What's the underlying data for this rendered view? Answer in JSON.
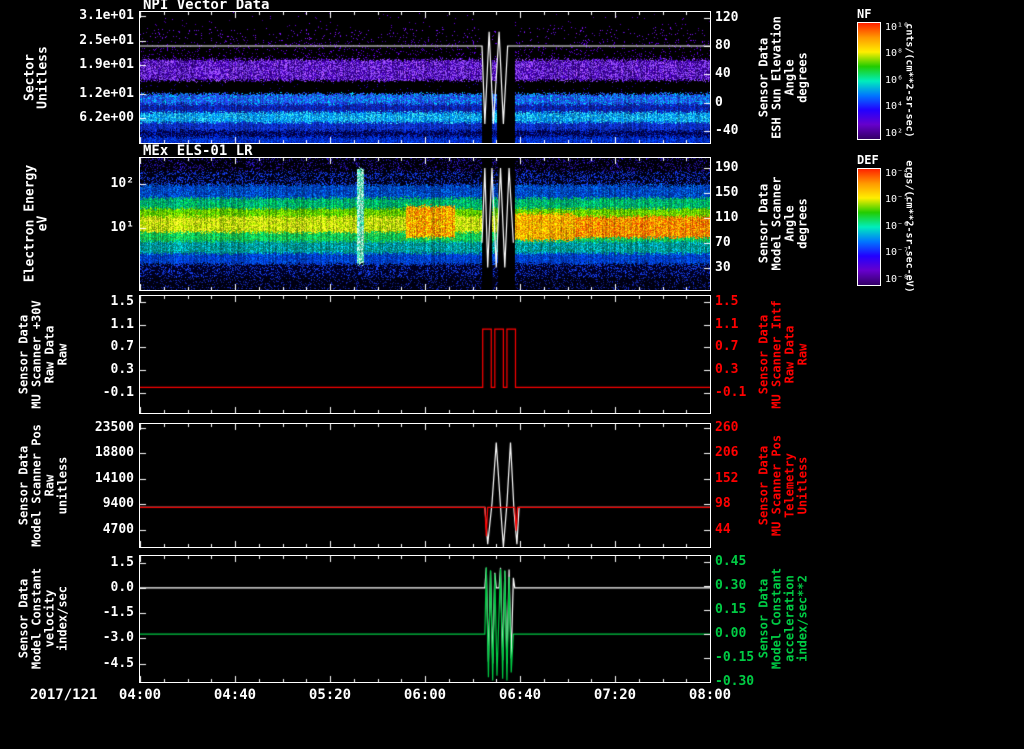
{
  "figure": {
    "background": "#000000"
  },
  "xaxis": {
    "date": "2017/121",
    "tick_labels": [
      "04:00",
      "04:40",
      "05:20",
      "06:00",
      "06:40",
      "07:20",
      "08:00"
    ],
    "minor_tick_minutes": 10,
    "major_tick_minutes": 40,
    "time_range": [
      "2017/121 04:00",
      "2017/121 08:00"
    ]
  },
  "colorbars": [
    {
      "label": "NF",
      "unit": "cnts/(cm**2-sr-sec)",
      "tick_labels": [
        "10^10",
        "10^8",
        "10^6",
        "10^4",
        "10^2"
      ],
      "colors": [
        "#ff2200",
        "#ff9900",
        "#ffee00",
        "#22cc00",
        "#00eebb",
        "#0077ff",
        "#2200ff",
        "#6600cc",
        "#330066"
      ]
    },
    {
      "label": "DEF",
      "unit": "ergs/(cm**2-sr-sec-eV)",
      "tick_labels": [
        "10^-4",
        "10^-5",
        "10^-6",
        "10^-7",
        "10^-8"
      ],
      "colors": [
        "#ff2200",
        "#ff9900",
        "#ffee00",
        "#22cc00",
        "#00eebb",
        "#0077ff",
        "#2200ff",
        "#6600cc",
        "#330066"
      ]
    }
  ],
  "chart_data": [
    {
      "id": "npi-vector-data",
      "type": "heatmap",
      "title": "NPI Vector Data",
      "left_axis": {
        "label_lines": [
          "Sector",
          "Unitless"
        ],
        "tick_labels": [
          "3.1e+01",
          "2.5e+01",
          "1.9e+01",
          "1.2e+01",
          "6.2e+00"
        ],
        "tick_values": [
          31,
          25,
          19,
          12,
          6.2
        ],
        "min": 0,
        "max": 32,
        "color": "#ffffff"
      },
      "right_axis": {
        "label_lines": [
          "Sensor Data",
          "ESH Sun Elevation",
          "Angle",
          "degrees"
        ],
        "tick_labels": [
          "120",
          "80",
          "40",
          "0",
          "-40"
        ],
        "tick_values": [
          120,
          80,
          40,
          0,
          -40
        ],
        "min": -57,
        "max": 128,
        "color": "#ffffff"
      },
      "bands": [
        {
          "f0": 0.0,
          "f1": 0.12,
          "base": "#000000",
          "speckle": "#5500bb",
          "density": 0.012
        },
        {
          "f0": 0.12,
          "f1": 0.22,
          "base": "#000000",
          "speckle": "#6611dd",
          "density": 0.045
        },
        {
          "f0": 0.22,
          "f1": 0.36,
          "base": "#000000",
          "speckle": "#5500cc",
          "density": 0.08
        },
        {
          "f0": 0.36,
          "f1": 0.52,
          "base": "#3a0099",
          "speckle": "#8844ff",
          "density": 0.45
        },
        {
          "f0": 0.52,
          "f1": 0.62,
          "base": "#000000",
          "speckle": "#2200aa",
          "density": 0.02
        },
        {
          "f0": 0.62,
          "f1": 0.7,
          "base": "#2244ee",
          "speckle": "#00aaff",
          "density": 0.35
        },
        {
          "f0": 0.7,
          "f1": 0.76,
          "base": "#101d99",
          "speckle": "#0033dd",
          "density": 0.3
        },
        {
          "f0": 0.76,
          "f1": 0.84,
          "base": "#0088ee",
          "speckle": "#33ddff",
          "density": 0.35
        },
        {
          "f0": 0.84,
          "f1": 0.9,
          "base": "#1133cc",
          "speckle": "#0022aa",
          "density": 0.3
        },
        {
          "f0": 0.9,
          "f1": 0.95,
          "base": "#000044",
          "speckle": "#0022bb",
          "density": 0.35
        },
        {
          "f0": 0.95,
          "f1": 1.03,
          "base": "#0022bb",
          "speckle": "#0044ee",
          "density": 0.35
        }
      ],
      "dropouts": [
        [
          6.4,
          6.47
        ],
        [
          6.5,
          6.63
        ]
      ],
      "overlay": {
        "name": "ESH Sun Elevation Angle",
        "color": "#ffffff",
        "axis": "right",
        "points": [
          [
            4.0,
            80
          ],
          [
            6.4,
            80
          ],
          [
            6.42,
            -30
          ],
          [
            6.45,
            100
          ],
          [
            6.48,
            -30
          ],
          [
            6.52,
            100
          ],
          [
            6.55,
            -30
          ],
          [
            6.58,
            80
          ],
          [
            8.0,
            80
          ]
        ]
      }
    },
    {
      "id": "mex-els-01-lr",
      "type": "heatmap",
      "title": "MEx ELS-01 LR",
      "left_axis": {
        "label_lines": [
          "Electron Energy",
          "eV"
        ],
        "tick_labels": [
          "10^2",
          "10^1"
        ],
        "tick_values": [
          100,
          10
        ],
        "min": 0.4,
        "max": 400,
        "scale": "log",
        "color": "#ffffff"
      },
      "right_axis": {
        "label_lines": [
          "Sensor Data",
          "Model Scanner",
          "Angle",
          "degrees"
        ],
        "tick_labels": [
          "190",
          "150",
          "110",
          "70",
          "30"
        ],
        "tick_values": [
          190,
          150,
          110,
          70,
          30
        ],
        "min": -6,
        "max": 206,
        "color": "#ffffff"
      },
      "bands": [
        {
          "f0": -0.02,
          "f1": 0.1,
          "base": "#000008",
          "speckle": "#221199",
          "density": 0.22
        },
        {
          "f0": 0.1,
          "f1": 0.2,
          "base": "#000014",
          "speckle": "#1133cc",
          "density": 0.33
        },
        {
          "f0": 0.2,
          "f1": 0.3,
          "base": "#0033aa",
          "speckle": "#0066dd",
          "density": 0.4
        },
        {
          "f0": 0.3,
          "f1": 0.38,
          "base": "#009977",
          "speckle": "#00cc55",
          "density": 0.45
        },
        {
          "f0": 0.38,
          "f1": 0.44,
          "base": "#44bb00",
          "speckle": "#88dd00",
          "density": 0.45
        },
        {
          "f0": 0.44,
          "f1": 0.56,
          "base": "#99cc00",
          "speckle": "#eeee22",
          "density": 0.5
        },
        {
          "f0": 0.56,
          "f1": 0.63,
          "base": "#22bb44",
          "speckle": "#00cc66",
          "density": 0.45
        },
        {
          "f0": 0.63,
          "f1": 0.72,
          "base": "#008877",
          "speckle": "#00aacc",
          "density": 0.4
        },
        {
          "f0": 0.72,
          "f1": 0.8,
          "base": "#0033bb",
          "speckle": "#0055dd",
          "density": 0.35
        },
        {
          "f0": 0.8,
          "f1": 0.9,
          "base": "#000022",
          "speckle": "#1133cc",
          "density": 0.28
        },
        {
          "f0": 0.9,
          "f1": 1.03,
          "base": "#000011",
          "speckle": "#112299",
          "density": 0.18
        }
      ],
      "enhancements": [
        {
          "t0": 5.86,
          "t1": 6.21,
          "f0": 0.36,
          "f1": 0.6,
          "base": "#ff7700",
          "speckle": "#ffdd00",
          "density": 0.45,
          "note": "orange flux blob before event"
        },
        {
          "t0": 6.63,
          "t1": 7.05,
          "f0": 0.42,
          "f1": 0.62,
          "base": "#ffcc00",
          "speckle": "#ff8800",
          "density": 0.45,
          "note": "bright band after event"
        },
        {
          "t0": 7.05,
          "t1": 8.0,
          "f0": 0.44,
          "f1": 0.6,
          "base": "#ffaa00",
          "speckle": "#ff5500",
          "density": 0.4,
          "note": "late orange band"
        },
        {
          "t0": 5.52,
          "t1": 5.57,
          "f0": 0.08,
          "f1": 0.8,
          "base": "#33ddaa",
          "speckle": "#bbffdd",
          "density": 0.5,
          "note": "narrow vertical streak"
        }
      ],
      "dropouts": [
        [
          6.4,
          6.47
        ],
        [
          6.51,
          6.63
        ]
      ],
      "overlay": {
        "name": "Model Scanner Angle",
        "color": "#ffffff",
        "axis": "right",
        "points": [
          [
            6.4,
            70
          ],
          [
            6.42,
            190
          ],
          [
            6.44,
            30
          ],
          [
            6.47,
            190
          ],
          [
            6.5,
            30
          ],
          [
            6.53,
            190
          ],
          [
            6.56,
            30
          ],
          [
            6.59,
            190
          ],
          [
            6.62,
            70
          ]
        ]
      }
    },
    {
      "id": "mu-scanner-intf",
      "type": "line",
      "left_axis": {
        "label_lines": [
          "Sensor Data",
          "MU Scanner +30V",
          "Raw Data",
          "Raw"
        ],
        "tick_labels": [
          "1.5",
          "1.1",
          "0.7",
          "0.3",
          "-0.1"
        ],
        "tick_values": [
          1.5,
          1.1,
          0.7,
          0.3,
          -0.1
        ],
        "min": -0.45,
        "max": 1.6,
        "color": "#ffffff"
      },
      "right_axis": {
        "label_lines": [
          "Sensor Data",
          "MU Scanner Intf",
          "Raw Data",
          "Raw"
        ],
        "tick_labels": [
          "1.5",
          "1.1",
          "0.7",
          "0.3",
          "-0.1"
        ],
        "tick_values": [
          1.5,
          1.1,
          0.7,
          0.3,
          -0.1
        ],
        "min": -0.45,
        "max": 1.6,
        "color": "#ff0000"
      },
      "series": [
        {
          "name": "MU Scanner Intf Raw Data",
          "color": "#ff0000",
          "axis": "left",
          "points": [
            [
              4.0,
              0
            ],
            [
              6.405,
              0
            ],
            [
              6.405,
              1.02
            ],
            [
              6.465,
              1.02
            ],
            [
              6.465,
              0
            ],
            [
              6.49,
              0
            ],
            [
              6.49,
              1.02
            ],
            [
              6.55,
              1.02
            ],
            [
              6.55,
              0
            ],
            [
              6.575,
              0
            ],
            [
              6.575,
              1.02
            ],
            [
              6.635,
              1.02
            ],
            [
              6.635,
              0
            ],
            [
              8.0,
              0
            ]
          ]
        }
      ]
    },
    {
      "id": "scanner-pos",
      "type": "line",
      "left_axis": {
        "label_lines": [
          "Sensor Data",
          "Model Scanner Pos",
          "Raw",
          "unitless"
        ],
        "tick_labels": [
          "23500",
          "18800",
          "14100",
          "9400",
          "4700"
        ],
        "tick_values": [
          23500,
          18800,
          14100,
          9400,
          4700
        ],
        "min": 1500,
        "max": 24200,
        "color": "#ffffff"
      },
      "right_axis": {
        "label_lines": [
          "Sensor Data",
          "MU Scanner Pos",
          "Telemetry",
          "Unitless"
        ],
        "tick_labels": [
          "260",
          "206",
          "152",
          "98",
          "44"
        ],
        "tick_values": [
          260,
          206,
          152,
          98,
          44
        ],
        "min": 7,
        "max": 268,
        "color": "#ff0000"
      },
      "series": [
        {
          "name": "Model Scanner Pos Raw",
          "color": "#ffffff",
          "axis": "left",
          "points": [
            [
              4.0,
              8800
            ],
            [
              6.42,
              8800
            ],
            [
              6.44,
              2000
            ],
            [
              6.47,
              9500
            ],
            [
              6.5,
              20800
            ],
            [
              6.53,
              9000
            ],
            [
              6.55,
              1500
            ],
            [
              6.575,
              9500
            ],
            [
              6.6,
              20800
            ],
            [
              6.625,
              8000
            ],
            [
              6.645,
              2000
            ],
            [
              6.66,
              8800
            ],
            [
              8.0,
              8800
            ]
          ]
        },
        {
          "name": "MU Scanner Pos Telemetry",
          "color": "#ff0000",
          "axis": "left",
          "points": [
            [
              4.0,
              8800
            ],
            [
              6.42,
              8800
            ],
            [
              6.43,
              3500
            ],
            [
              6.44,
              8800
            ],
            [
              6.63,
              8800
            ],
            [
              6.64,
              4500
            ],
            [
              6.65,
              8800
            ],
            [
              8.0,
              8800
            ]
          ]
        }
      ]
    },
    {
      "id": "model-constant",
      "type": "line",
      "left_axis": {
        "label_lines": [
          "Sensor Data",
          "Model Constant",
          "velocity",
          "index/sec"
        ],
        "tick_labels": [
          "1.5",
          "0.0",
          "-1.5",
          "-3.0",
          "-4.5"
        ],
        "tick_values": [
          1.5,
          0.0,
          -1.5,
          -3.0,
          -4.5
        ],
        "min": -5.6,
        "max": 1.9,
        "color": "#ffffff"
      },
      "right_axis": {
        "label_lines": [
          "Sensor Data",
          "Model Constant",
          "acceleration",
          "index/sec**2"
        ],
        "tick_labels": [
          "0.45",
          "0.30",
          "0.15",
          "0.00",
          "-0.15",
          "-0.30"
        ],
        "tick_values": [
          0.45,
          0.3,
          0.15,
          0.0,
          -0.15,
          -0.3
        ],
        "min": -0.3,
        "max": 0.49,
        "color": "#00cc44"
      },
      "series": [
        {
          "name": "Model Constant velocity",
          "color": "#ffffff",
          "axis": "left",
          "points": [
            [
              4.0,
              0
            ],
            [
              6.42,
              0
            ],
            [
              6.43,
              1.2
            ],
            [
              6.445,
              -4.4
            ],
            [
              6.46,
              1.0
            ],
            [
              6.475,
              -4.5
            ],
            [
              6.49,
              0.9
            ],
            [
              6.5,
              0
            ],
            [
              6.52,
              0
            ],
            [
              6.53,
              1.2
            ],
            [
              6.545,
              -4.3
            ],
            [
              6.56,
              1.0
            ],
            [
              6.575,
              -4.5
            ],
            [
              6.59,
              1.1
            ],
            [
              6.605,
              -4.2
            ],
            [
              6.62,
              0.6
            ],
            [
              6.63,
              0
            ],
            [
              8.0,
              0
            ]
          ]
        },
        {
          "name": "Model Constant acceleration",
          "color": "#00cc44",
          "axis": "right",
          "points": [
            [
              4.0,
              0
            ],
            [
              6.42,
              0
            ],
            [
              6.43,
              0.42
            ],
            [
              6.445,
              -0.27
            ],
            [
              6.46,
              0.4
            ],
            [
              6.475,
              -0.29
            ],
            [
              6.49,
              0.38
            ],
            [
              6.505,
              -0.26
            ],
            [
              6.53,
              0.41
            ],
            [
              6.545,
              -0.28
            ],
            [
              6.56,
              0.4
            ],
            [
              6.575,
              -0.29
            ],
            [
              6.59,
              0.36
            ],
            [
              6.605,
              -0.24
            ],
            [
              6.62,
              0
            ],
            [
              8.0,
              0
            ]
          ]
        }
      ]
    }
  ]
}
